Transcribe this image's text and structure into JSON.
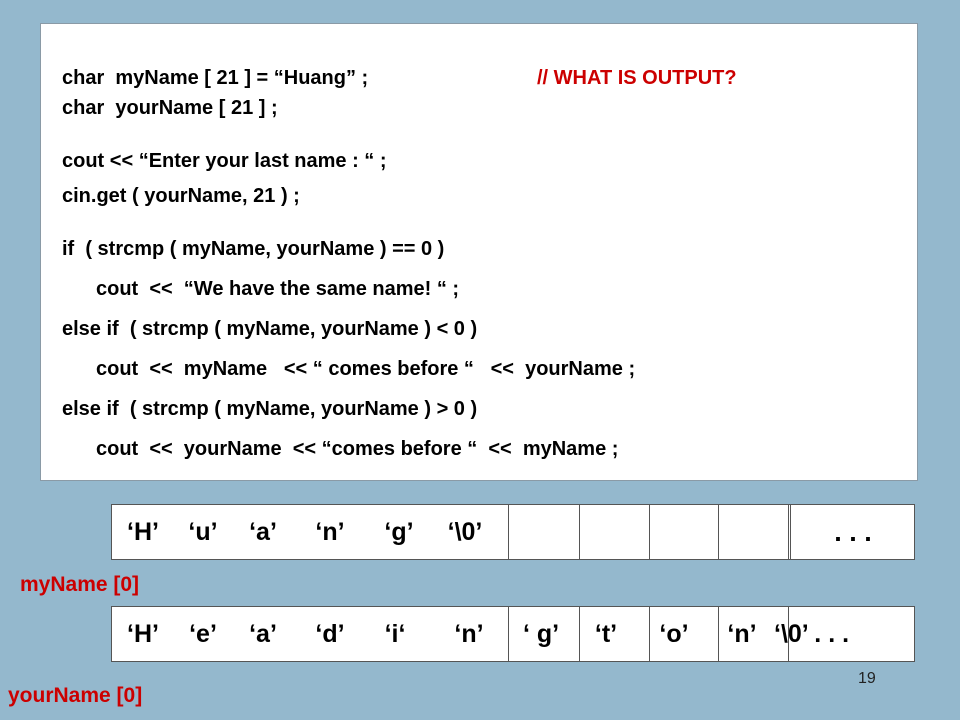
{
  "code": {
    "line1": "char  myName [ 21 ] = “Huang” ;",
    "line1_comment": "// WHAT IS OUTPUT?",
    "line2": "char  yourName [ 21 ] ;",
    "line3": "cout << “Enter your last name : “ ;",
    "line4": "cin.get ( yourName, 21 ) ;",
    "line5": "if  ( strcmp ( myName, yourName ) == 0 )",
    "line6": "cout  <<  “We have the same name! “ ;",
    "line7": "else if  ( strcmp ( myName, yourName ) < 0 )",
    "line8": "cout  <<  myName   << “ comes before “   <<  yourName ;",
    "line9": "else if  ( strcmp ( myName, yourName ) > 0 )",
    "line10": "cout  <<  yourName  << “comes before “  <<  myName ;"
  },
  "my_name_array": {
    "cells": [
      "‘H’",
      "‘u’",
      "‘a’",
      "‘n’",
      "‘g’",
      "‘\\0’"
    ],
    "ellipsis": ". . ."
  },
  "my_name_label": "myName [0]",
  "your_name_array": {
    "cells": [
      "‘H’",
      "‘e’",
      "‘a’",
      "‘d’",
      "‘i‘",
      "‘n’",
      "‘ g’",
      "‘t’",
      "‘o’",
      "‘n’",
      "‘\\0’ . . ."
    ]
  },
  "your_name_label": "yourName [0]",
  "slide_number": "19",
  "colors": {
    "background": "#94b8cd",
    "comment": "#cc0000",
    "label": "#cc0000"
  }
}
